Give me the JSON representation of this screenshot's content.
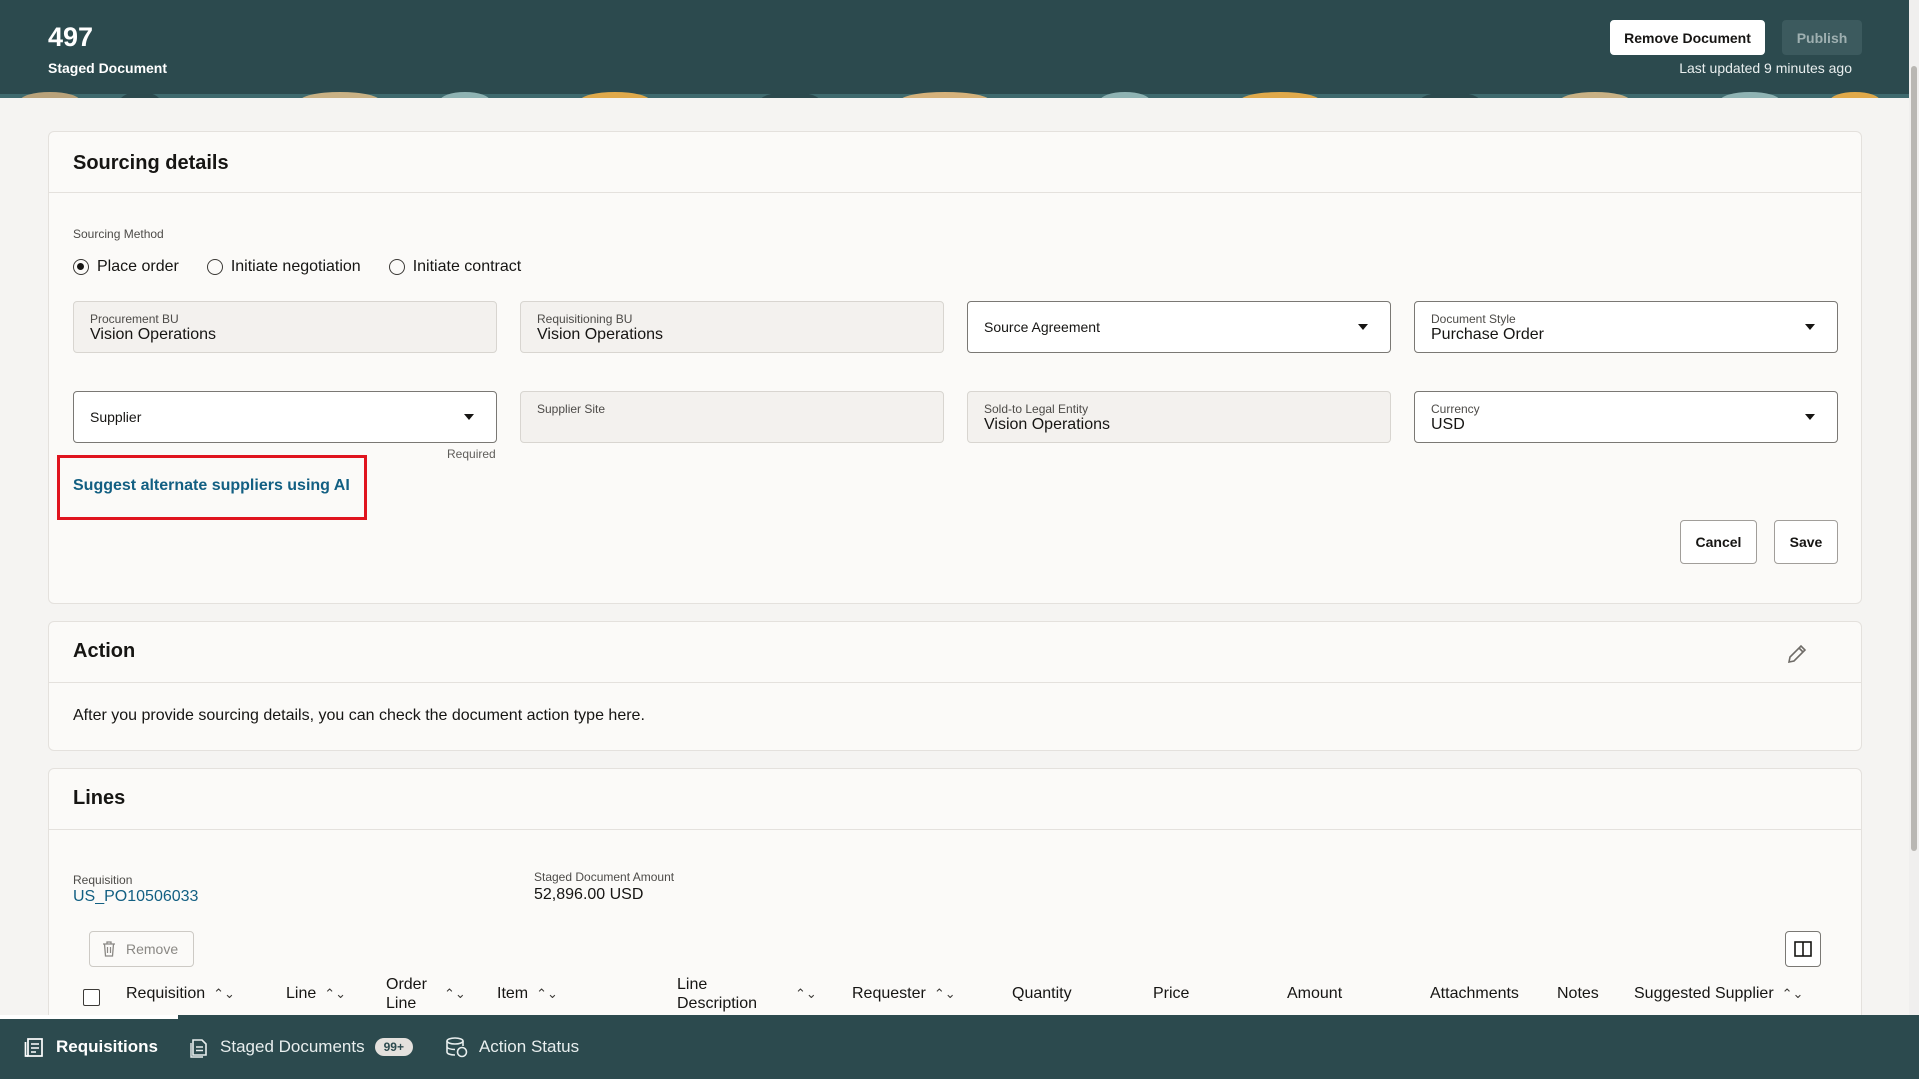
{
  "header": {
    "doc_number": "497",
    "doc_type": "Staged Document",
    "remove_label": "Remove Document",
    "publish_label": "Publish",
    "last_updated": "Last updated 9 minutes ago"
  },
  "sourcing": {
    "title": "Sourcing details",
    "method_label": "Sourcing Method",
    "methods": [
      "Place order",
      "Initiate negotiation",
      "Initiate contract"
    ],
    "selected_method": "Place order",
    "procurement_bu_label": "Procurement BU",
    "procurement_bu": "Vision Operations",
    "requisitioning_bu_label": "Requisitioning BU",
    "requisitioning_bu": "Vision Operations",
    "source_agreement_label": "Source Agreement",
    "document_style_label": "Document Style",
    "document_style": "Purchase Order",
    "supplier_label": "Supplier",
    "supplier_required": "Required",
    "supplier_site_label": "Supplier Site",
    "legal_entity_label": "Sold-to Legal Entity",
    "legal_entity": "Vision Operations",
    "currency_label": "Currency",
    "currency": "USD",
    "ai_link": "Suggest alternate suppliers using AI",
    "cancel_label": "Cancel",
    "save_label": "Save"
  },
  "action": {
    "title": "Action",
    "text": "After you provide sourcing details, you can check the document action type here."
  },
  "lines": {
    "title": "Lines",
    "requisition_label": "Requisition",
    "requisition": "US_PO10506033",
    "amount_label": "Staged Document Amount",
    "amount": "52,896.00 USD",
    "remove_label": "Remove",
    "columns": [
      "Requisition",
      "Line",
      "Order Line",
      "Item",
      "Line Description",
      "Requester",
      "Quantity",
      "Price",
      "Amount",
      "Attachments",
      "Notes",
      "Suggested Supplier"
    ]
  },
  "bottom_nav": {
    "items": [
      "Requisitions",
      "Staged Documents",
      "Action Status"
    ],
    "staged_badge": "99+"
  },
  "colors": {
    "header_bg": "#2c4a4e",
    "link": "#125f82",
    "highlight": "#e0141e"
  }
}
